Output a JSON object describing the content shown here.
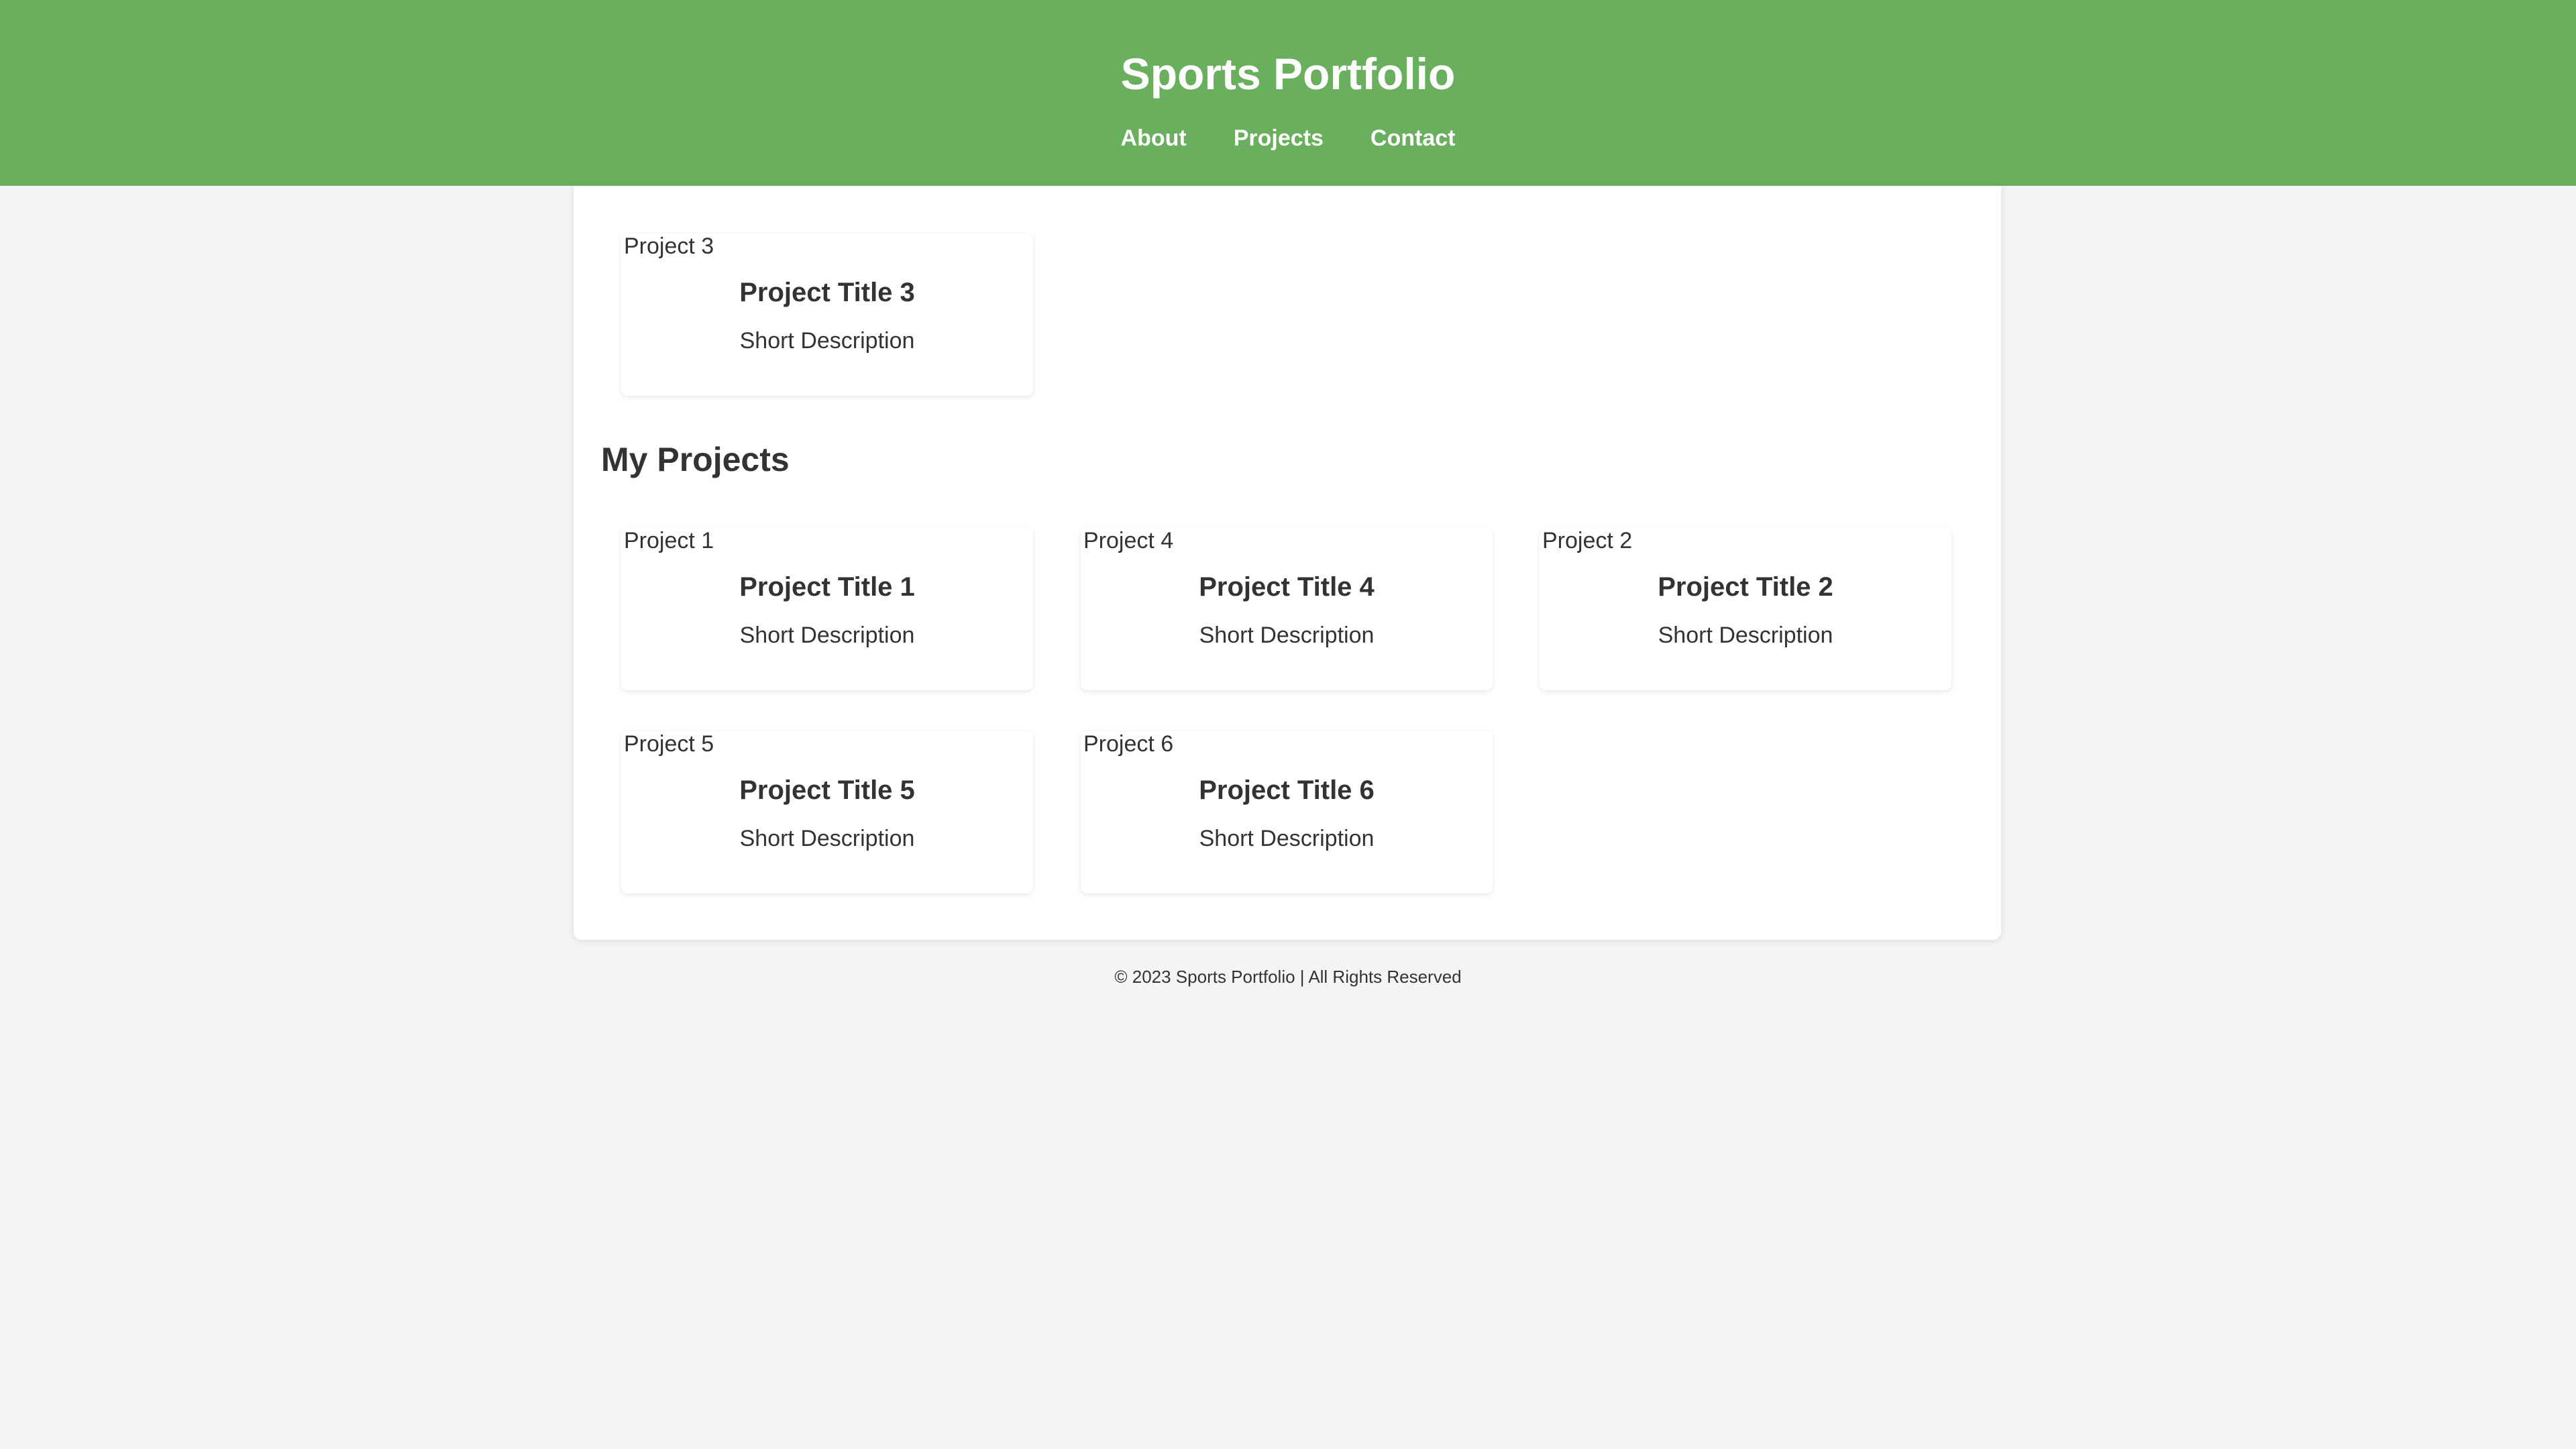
{
  "header": {
    "title": "Sports Portfolio",
    "nav": [
      {
        "label": "About"
      },
      {
        "label": "Projects"
      },
      {
        "label": "Contact"
      }
    ]
  },
  "featured_card": {
    "image_alt": "Project 3",
    "title": "Project Title 3",
    "description": "Short Description"
  },
  "projects_section": {
    "heading": "My Projects",
    "cards": [
      {
        "image_alt": "Project 1",
        "title": "Project Title 1",
        "description": "Short Description"
      },
      {
        "image_alt": "Project 4",
        "title": "Project Title 4",
        "description": "Short Description"
      },
      {
        "image_alt": "Project 2",
        "title": "Project Title 2",
        "description": "Short Description"
      },
      {
        "image_alt": "Project 5",
        "title": "Project Title 5",
        "description": "Short Description"
      },
      {
        "image_alt": "Project 6",
        "title": "Project Title 6",
        "description": "Short Description"
      }
    ]
  },
  "footer": {
    "text": "© 2023 Sports Portfolio | All Rights Reserved"
  },
  "colors": {
    "header_background": "#6aaf5d",
    "page_background": "#f4f4f4",
    "text": "#333333"
  }
}
